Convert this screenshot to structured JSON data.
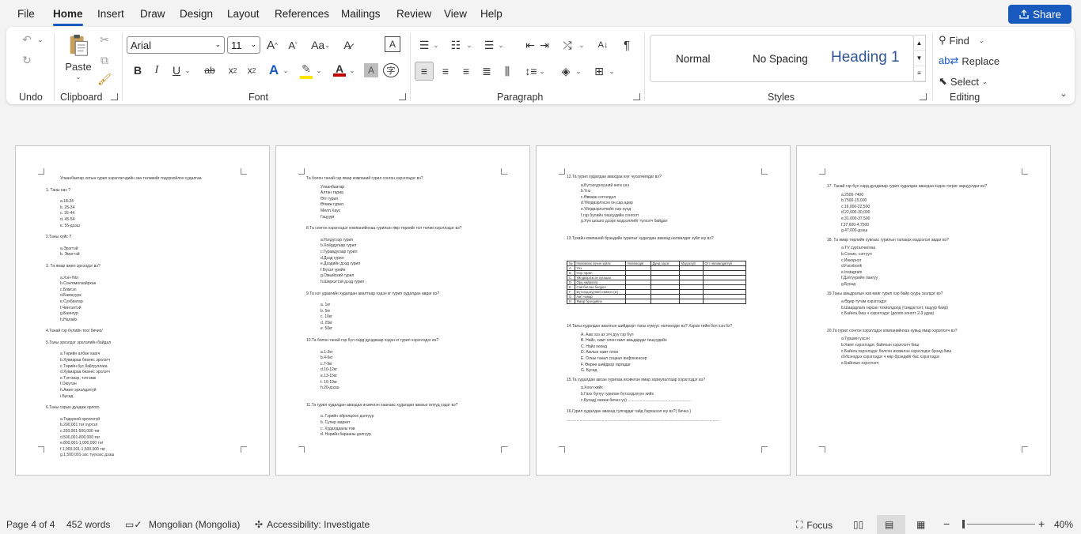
{
  "menu": {
    "tabs": [
      "File",
      "Home",
      "Insert",
      "Draw",
      "Design",
      "Layout",
      "References",
      "Mailings",
      "Review",
      "View",
      "Help"
    ],
    "active": "Home",
    "share_label": "Share"
  },
  "colors": {
    "accent": "#185abd",
    "heading": "#2f5597",
    "highlight": "#ffe600",
    "font_color": "#c00000"
  },
  "ribbon": {
    "groups": {
      "undo": "Undo",
      "clipboard": "Clipboard",
      "font": "Font",
      "paragraph": "Paragraph",
      "styles": "Styles",
      "editing": "Editing"
    },
    "paste_label": "Paste",
    "font_name": "Arial",
    "font_size": "11",
    "case_label": "Aa",
    "styles": {
      "normal": "Normal",
      "no_spacing": "No Spacing",
      "heading1": "Heading 1"
    },
    "editing": {
      "find": "Find",
      "replace": "Replace",
      "select": "Select"
    }
  },
  "pages": {
    "p1": [
      "Улаанбаатар хотын гурил хэрэглэгчдийн зан төлөвийг тодорхойлох судалгаа",
      "1. Таны нас ?",
      "а.18-24",
      "b. 25-34",
      "c. 35-44",
      "d. 45-54",
      "e. 55-дээш",
      "2.Таны хүйс ?",
      "а.Эрэгтэй",
      "b. Эмэгтэй",
      "3. Та ямар ажил эрхэлдэг вэ?",
      "а.Хэн-Үйл",
      "b.Сонгомолзайрхан",
      "c.Бямгэл",
      "d.Бамнуурх",
      "e.Сухбаатар",
      "f.Чингэлтэй",
      "g.Баянгүр",
      "h.Налайх",
      "4.Танай гэр бүлийн тоо/ бичих/",
      "5.Таны эрхэлдэг эрхлэлийн байдал",
      "а.Төрийн албан хаагч",
      "b.Хувиараа бизнес эрхлэгч",
      "c.Төрийн бус байгууллага",
      "d.Хувиараа бизнес эрхлэгч",
      "e.Тэтгэвэр, тэтгэмж",
      "f.Оюутан",
      "h.Ажил эрхэлдэггүй",
      "i.Бусад",
      "6.Таны сарын дундаж орлого",
      "а.Тодорхой орлогогүй",
      "b.200,001 төг хүртэл",
      "c.200,001-500,000 төг",
      "d.500,001-800,000 төг",
      "e.800,001-1,000,000 төг",
      "f.1,000,001-1,500,000 төг",
      "g.1,500,001-ээс түүнээс дээш"
    ],
    "p2": [
      "Та болон танай гэр ямар компаний гурил сонгон хэрэглэдэг вэ?",
      "Улаанбаатар",
      "Алтан тариа",
      "Өгт гурил",
      "Өгөөж гурил",
      "Милл Хаус",
      "Гацуурт",
      "8.Та сонгон хэрэглэдэг компанийнхаа гурилын ямр төрлийг гол төлөв хэрэглэдэг вэ?",
      "а.Нэгдүгээр гурил",
      "b.Хоёрдугаар гурил",
      "c.Гуравдугаар гурил",
      "d.Дээд гурил",
      "e.Дээдийн дээд гурил",
      "f.Бүхэл үрийн",
      "g.Омыйский гурил",
      "h.Ширхэгтэй дээд гурил",
      "9.Та нэг удаагийн худалдан авалтаар хэдэн кг гурил худалдан авдаг вэ?",
      "а. 1кг",
      "b. 5кг",
      "c. 10кг",
      "d. 25кг",
      "e. 50кг",
      "10.Та болон танай гэр бүл сард дунджаар хэдэн кг гурил хэрэглэдэг вэ?",
      "а.1-3кг",
      "b.4-6кг",
      "c.7-9кг",
      "d.10-12кг",
      "e.13-15кг",
      "f. 16-19кг",
      "h.20-дээш",
      "11.Та гурил худалдан авахдаа ихэвчлэн хаанаас худалдан авахыг илүүд үздэг вэ?",
      "а. Гэрийн ойролцоох дэлгүүр",
      "b. Супер маркет",
      "c. Худалдааны төв",
      "d. Нэрийн барааны дэлгүүр"
    ],
    "p3": [
      "12.Та гурил худалдан авахдаа юуг чухалчилдаг вэ?",
      "а.Бүтээгдэхүүний өнгө үнэ",
      "b.Үнэ",
      "c.Өвмөж сэтгэлдэл",
      "d.Үйлдвэрлэсэн он,сар,өдөр",
      "e.Үйлдвэрлэгчийн нэр хүнд",
      "f.гэр бүлийн гишүүдийн сонголт",
      "g.Хүн шошго дээрх мэдээллийг түлхэгч байдал",
      "13.Тухайн компаний брэндийн гурилыг худалдан авахад нөлөөлдөг зүйл юу вэ?",
      "14.Таны худалдан авалтын шийдвэрт таны хүмүүс нөлөөлдөг вэ? Хэрэв тийм бол хэн бэ?",
      "A.  Аав эээ ах эгч дүү гэр бүл",
      "B.  Найз, хамт олон хамт амьдардаг гишүүдийн",
      "C.  Найз нөхөд",
      "D.  Ажлын хамт олон",
      "E.  Олны танил социал инфлюенсер",
      "F.  Өөрөө шийдвэр гаргадаг",
      "G.  Бусад",
      "15.Та худалдан авсан гурилаа ихэвчлэн ямар зориулалтаар хэрэглэдэг вэ?",
      "а.Хоол хийх",
      "b.Гахх булуу гурилан бүтээгдэхүүн хийх",
      "c.Бусад( нөхөж бичнэ үү) ..........................................................",
      "16.Гурил худалдан авахад тулгардаг гайд бэрхшээл юу вэ?( бичнэ )",
      "..........................................................................................................................................."
    ],
    "p3_table": {
      "header": [
        "№",
        "Нөлөөлөх хүчин зүйлс",
        "Нөлөөлдөг",
        "Дунд зэрэг",
        "Мэдэхгүй",
        "Огт нөлөөлдөггүй"
      ],
      "rows": [
        [
          "A",
          "Үнэ"
        ],
        [
          "B",
          "Нэр төрөл"
        ],
        [
          "C",
          "Үйлдвэрлэсэн хугацаа"
        ],
        [
          "D",
          "Орц найрлага"
        ],
        [
          "E",
          "Сав баглаа боодол"
        ],
        [
          "F",
          "Бүтээгдэхүүний хэмжээ (кг)"
        ],
        [
          "G",
          "Амт чанар"
        ],
        [
          "H",
          "Ямар брэндийнх"
        ]
      ]
    },
    "p4": [
      "17. Танай гэр бүл сард дунджаар гурил худалдан авахдаа хэдэн төгрөг зарцуулдаг вэ?",
      "а.2500-7400",
      "b.7500-15,000",
      "c.16,000-22,500",
      "d.22,600-30,000",
      "e.31,000-37,500",
      "f.37,600-4,7500",
      "g.47,600-дээш",
      "18. Та ямар төрлийн сувгаас гурилын талаарх мэдээлэл авдаг вэ?",
      "а.TV сурталчилгаа",
      "b.Сонин, сэтгүүл",
      "c.Инкорнэт",
      "d.Facebook",
      "e.Instagram",
      "f.Дэлгүүрийн лангуу",
      "g.Бусад",
      "19.Таны амьдралын хэв маяг гурил хэр байр суурь эзэлдэг вэ?",
      "а.Өдөр тутам хэрэглэдэг",
      "b.Шаардлага гарсан тохиолдолд (тэмдэглэгт, гацуур баяр)",
      "c.Байнга биш ч хэрэглэдэг (долоо хоногт 2-3 удаа)",
      "20.Та гурил сонгон хэрэглэдэг компанийнхаа хувьд ямар хэрэглэгч вэ?",
      "а.Туршин үзсэн",
      "b.Хамт хэрэглэдэг, байнгын хэрэглэгч биш",
      "c.Байнга хэрэглэдэг болсон ихэвчлэн хэрэглэдэг брэнд биш",
      "d.Ихэнхдээ хэрэглэдэг ч өөр брэндийг бас хэрэглэдэг",
      "e.Байнгын хэрэглэгч"
    ]
  },
  "status": {
    "page": "Page 4 of 4",
    "words": "452 words",
    "language": "Mongolian (Mongolia)",
    "accessibility": "Accessibility: Investigate",
    "focus": "Focus",
    "zoom": "40%"
  }
}
